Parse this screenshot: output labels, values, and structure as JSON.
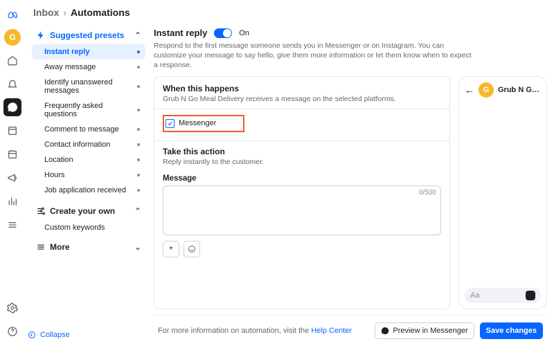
{
  "rail": {
    "avatar_letter": "G"
  },
  "breadcrumb": {
    "parent": "Inbox",
    "current": "Automations"
  },
  "sidebar": {
    "group_suggested": "Suggested presets",
    "items": [
      {
        "label": "Instant reply"
      },
      {
        "label": "Away message"
      },
      {
        "label": "Identify unanswered messages"
      },
      {
        "label": "Frequently asked questions"
      },
      {
        "label": "Comment to message"
      },
      {
        "label": "Contact information"
      },
      {
        "label": "Location"
      },
      {
        "label": "Hours"
      },
      {
        "label": "Job application received"
      }
    ],
    "group_create": "Create your own",
    "create_items": [
      {
        "label": "Custom keywords"
      }
    ],
    "group_more": "More",
    "collapse": "Collapse"
  },
  "content": {
    "title": "Instant reply",
    "state": "On",
    "description": "Respond to the first message someone sends you in Messenger or on Instagram. You can customize your message to say hello, give them more information or let them know when to expect a response.",
    "when_h": "When this happens",
    "when_s": "Grub N Go Meal Delivery receives a message on the selected platforms.",
    "messenger": "Messenger",
    "action_h": "Take this action",
    "action_s": "Reply instantly to the customer.",
    "msg_label": "Message",
    "counter": "0/500"
  },
  "preview": {
    "name": "Grub N Go M...",
    "avatar_letter": "G",
    "input_placeholder": "Aa"
  },
  "footer": {
    "info_pre": "For more information on automation, visit the ",
    "help_link": "Help Center",
    "preview_btn": "Preview in Messenger",
    "save_btn": "Save changes"
  }
}
